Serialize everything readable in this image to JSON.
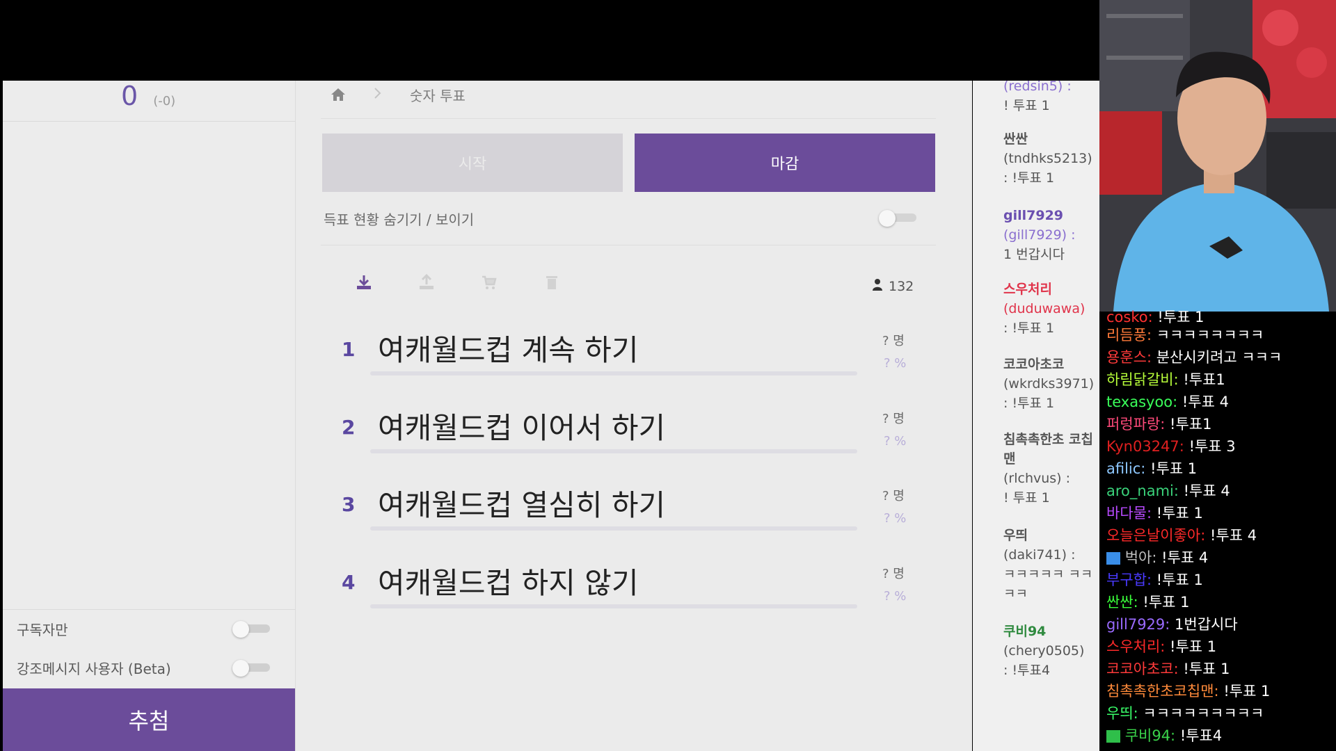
{
  "left_panel": {
    "score": "0",
    "score_delta": "(-0)",
    "subscriber_only_label": "구독자만",
    "highlight_label": "강조메시지 사용자 (Beta)",
    "draw_button": "추첨"
  },
  "breadcrumb": {
    "home_icon": "home-icon",
    "separator_icon": "chevron-right-icon",
    "current": "숫자 투표"
  },
  "controls": {
    "start_label": "시작",
    "end_label": "마감",
    "hide_results_label": "득표 현황 숨기기 / 보이기"
  },
  "toolbar": {
    "icons": [
      "download-icon",
      "upload-icon",
      "cart-icon",
      "trash-icon"
    ],
    "voter_icon": "user-icon",
    "voter_count": "132"
  },
  "poll_items": [
    {
      "num": "1",
      "label": "여캐월드컵 계속 하기",
      "count": "? 명",
      "percent": "? %"
    },
    {
      "num": "2",
      "label": "여캐월드컵 이어서 하기",
      "count": "? 명",
      "percent": "? %"
    },
    {
      "num": "3",
      "label": "여캐월드컵 열심히 하기",
      "count": "? 명",
      "percent": "? %"
    },
    {
      "num": "4",
      "label": "여캐월드컵 하지 않기",
      "count": "? 명",
      "percent": "? %"
    }
  ],
  "overlay_chat": [
    {
      "nick": "",
      "id": "(redsin5) :",
      "text": "! 투표 1",
      "color": "#8a6fcf"
    },
    {
      "nick": "싼싼",
      "id": "(tndhks5213)",
      "text": ": !투표 1",
      "color": "#555555"
    },
    {
      "nick": "gill7929",
      "id": "(gill7929) :",
      "text": "1 번갑시다",
      "color": "#6a4fb0"
    },
    {
      "nick": "스우처리",
      "id": "(duduwawa)",
      "text": ": !투표 1",
      "color": "#e0334a"
    },
    {
      "nick": "코코아초코",
      "id": "(wkrdks3971)",
      "text": ": !투표 1",
      "color": "#555555"
    },
    {
      "nick": "침촉촉한초 코칩맨",
      "id": "(rlchvus) :",
      "text": "! 투표 1",
      "color": "#555555"
    },
    {
      "nick": "우띄",
      "id": "(daki741) :",
      "text": "ㅋㅋㅋㅋㅋ ㅋㅋㅋㅋ",
      "color": "#555555"
    },
    {
      "nick": "쿠비94",
      "id": "(chery0505)",
      "text": ": !투표4",
      "color": "#2f8a3f"
    }
  ],
  "chat": [
    {
      "nick": "cosko:",
      "text": "!투표 1",
      "color": "#ff3030"
    },
    {
      "nick": "리듬풍:",
      "text": "ㅋㅋㅋㅋㅋㅋㅋㅋ",
      "color": "#ff7a3a"
    },
    {
      "nick": "용훈스:",
      "text": "분산시키려고 ㅋㅋㅋ",
      "color": "#ff3a3a"
    },
    {
      "nick": "하림닭갈비:",
      "text": "!투표1",
      "color": "#b8ff3a"
    },
    {
      "nick": "texasyoo:",
      "text": "!투표 4",
      "color": "#3aff5a"
    },
    {
      "nick": "퍼렁파랑:",
      "text": "!투표1",
      "color": "#ff4a7a"
    },
    {
      "nick": "Kyn03247:",
      "text": "!투표 3",
      "color": "#e02020"
    },
    {
      "nick": "afilic:",
      "text": "!투표 1",
      "color": "#8ec8ff"
    },
    {
      "nick": "aro_nami:",
      "text": "!투표 4",
      "color": "#3ad27a"
    },
    {
      "nick": "바다물:",
      "text": "!투표 1",
      "color": "#b84aff"
    },
    {
      "nick": "오늘은날이좋아:",
      "text": "!투표 4",
      "color": "#ff2a2a"
    },
    {
      "nick": "벅아:",
      "text": "!투표 4",
      "color": "#c0c0c0"
    },
    {
      "nick": "부구합:",
      "text": "!투표 1",
      "color": "#4a3aff"
    },
    {
      "nick": "싼싼:",
      "text": "!투표 1",
      "color": "#3aff3a"
    },
    {
      "nick": "gill7929:",
      "text": "1번갑시다",
      "color": "#9a6aff"
    },
    {
      "nick": "스우처리:",
      "text": "!투표 1",
      "color": "#ff2a2a"
    },
    {
      "nick": "코코아초코:",
      "text": "!투표 1",
      "color": "#ff3a3a"
    },
    {
      "nick": "침촉촉한초코칩맨:",
      "text": "!투표 1",
      "color": "#ff8a3a"
    },
    {
      "nick": "우띄:",
      "text": "ㅋㅋㅋㅋㅋㅋㅋㅋㅋ",
      "color": "#3aff6a"
    },
    {
      "nick": "쿠비94:",
      "text": "!투표4",
      "color": "#3ad24a"
    }
  ]
}
